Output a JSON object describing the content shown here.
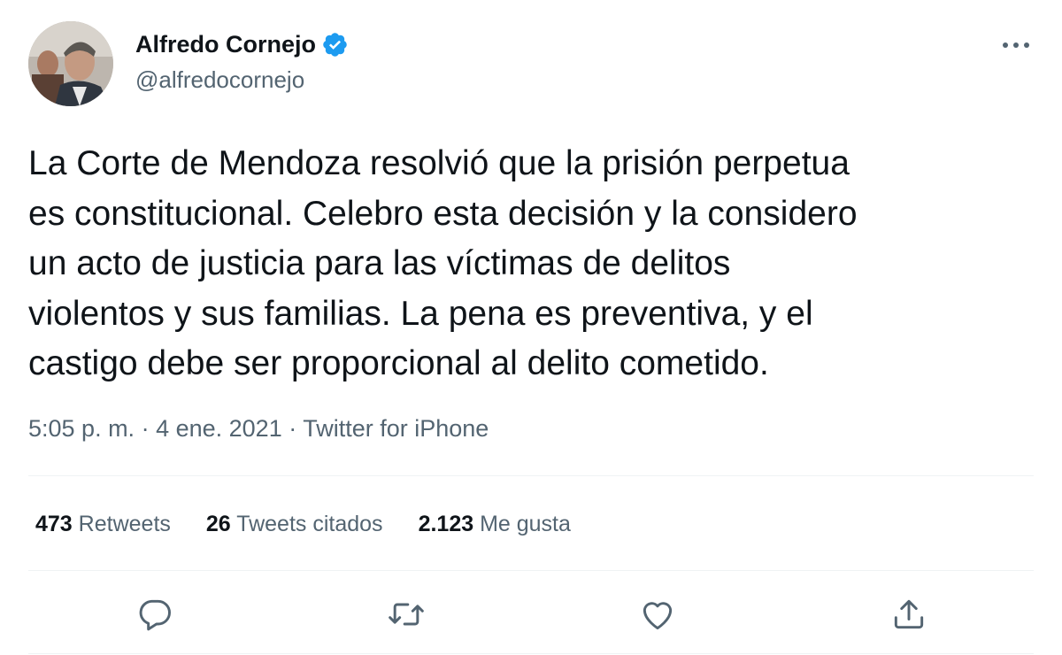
{
  "author": {
    "display_name": "Alfredo Cornejo",
    "handle": "@alfredocornejo"
  },
  "tweet": {
    "text": "La Corte de Mendoza resolvió que la prisión perpetua\nes constitucional. Celebro esta decisión y la considero\nun acto de justicia para las víctimas de delitos\nviolentos y sus familias. La pena es preventiva, y el\ncastigo debe ser proporcional al delito cometido.",
    "time": "5:05 p. m.",
    "date": "4 ene. 2021",
    "source": "Twitter for iPhone",
    "separator": " · "
  },
  "stats": {
    "retweets": {
      "count": "473",
      "label": "Retweets"
    },
    "quotes": {
      "count": "26",
      "label": "Tweets citados"
    },
    "likes": {
      "count": "2.123",
      "label": "Me gusta"
    }
  },
  "icons": {
    "more": "more-horizontal-icon",
    "verified": "verified-badge-icon",
    "reply": "reply-bubble-icon",
    "retweet": "retweet-arrows-icon",
    "like": "heart-icon",
    "share": "share-upload-icon"
  },
  "colors": {
    "text": "#0f1419",
    "secondary": "#536471",
    "verified": "#1d9bf0",
    "divider": "#eff3f4"
  }
}
